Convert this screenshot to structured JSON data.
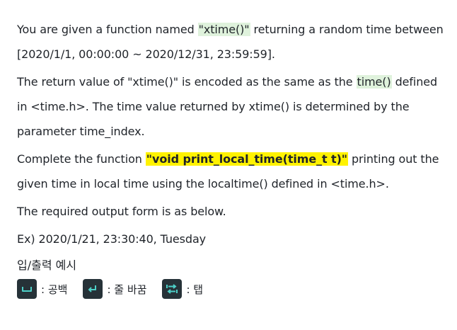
{
  "problem": {
    "p1": {
      "before": "You are given a function named ",
      "highlight": "\"xtime()\"",
      "after": " returning a random time between [2020/1/1, 00:00:00 ~ 2020/12/31, 23:59:59]."
    },
    "p2": {
      "before": "The return value of \"xtime()\" is encoded as the same as the ",
      "highlight": "time()",
      "after": " defined in <time.h>. The time value returned by xtime() is determined by the parameter time_index."
    },
    "p3": {
      "before": "Complete the function ",
      "highlight": "\"void print_local_time(time_t t)\"",
      "after": " printing out the given time in local time using the localtime() defined in <time.h>."
    },
    "p4": "The required output form is as below.",
    "p5": "Ex) 2020/1/21, 23:30:40, Tuesday"
  },
  "io_legend": {
    "title": "입/출력 예시",
    "items": [
      {
        "icon": "space-key-icon",
        "label": ": 공백"
      },
      {
        "icon": "newline-key-icon",
        "label": ": 줄 바꿈"
      },
      {
        "icon": "tab-key-icon",
        "label": ": 탭"
      }
    ],
    "colors": {
      "key_bg": "#263238",
      "key_fg": "#4dd0c8",
      "highlight_green": "#dff2dc",
      "highlight_yellow": "#fff200"
    }
  }
}
